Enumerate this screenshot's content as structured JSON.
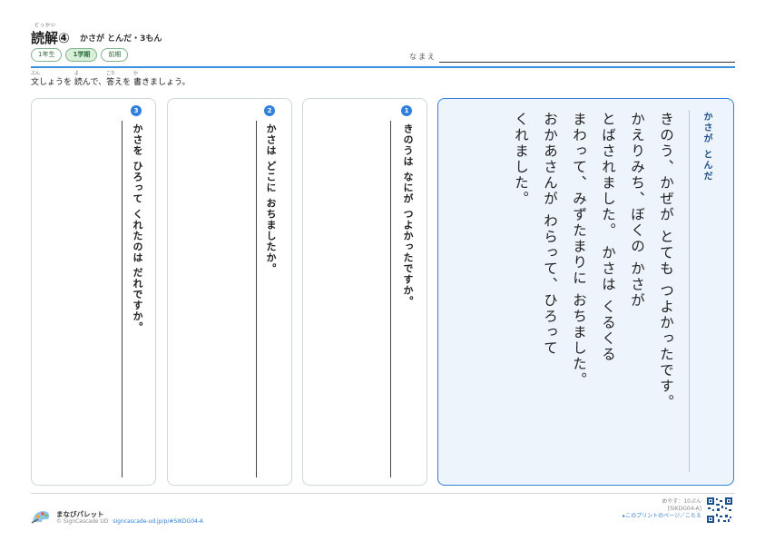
{
  "header": {
    "title_ruby": "どっかい",
    "title": "読解④",
    "subtitle": "かさが とんだ・3もん",
    "tags": [
      "1年生",
      "1学期",
      "前期"
    ],
    "name_label": "なまえ"
  },
  "instruction": {
    "w1": "文",
    "w1_ruby": "ぶん",
    "t1": "しょうを ",
    "w2": "読",
    "w2_ruby": "よ",
    "t2": "んで、",
    "w3": "答",
    "w3_ruby": "こた",
    "t3": "えを ",
    "w4": "書",
    "w4_ruby": "か",
    "t4": "きましょう。"
  },
  "questions": [
    {
      "num": "1",
      "text": "きのうは なにが つよかったですか。"
    },
    {
      "num": "2",
      "text": "かさは どこに おちましたか。"
    },
    {
      "num": "3",
      "text": "かさを ひろって くれたのは だれですか。"
    }
  ],
  "story": {
    "title": "かさが とんだ",
    "lines": [
      "きのう、かぜが とても つよかったです。",
      "かえりみち、ぼくの かさが",
      "とばされました。 かさは くるくる",
      "まわって、みずたまりに おちました。",
      "おかあさんが わらって、ひろって",
      "くれました。"
    ]
  },
  "footer": {
    "brand": "まなびパレット",
    "copyright": "© SignCascade UD",
    "url": "signcascade-ud.jp/p/#SIKDG04-A",
    "time": "めやす：10ぷん",
    "code": "[SIKDG04-A]",
    "link": "▸このプリントのページ／こたえ"
  },
  "colors": {
    "accent": "#2f7fdc",
    "story_bg": "#eef4fb",
    "tag_green": "#2f6e3b"
  }
}
